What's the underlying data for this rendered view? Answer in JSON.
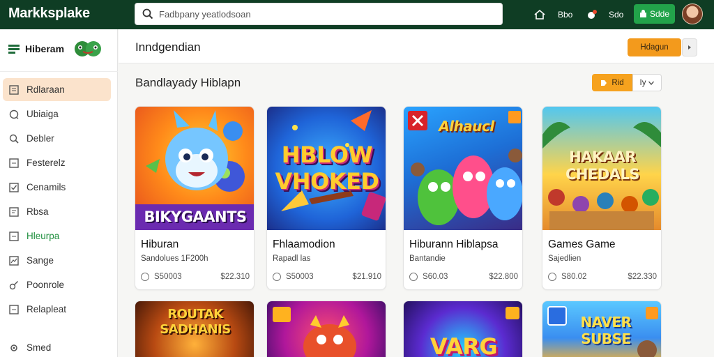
{
  "topbar": {
    "logo": "Markksplake",
    "search_placeholder": "Fadbpany yeatlodsoan",
    "home_label": "Bbo",
    "ns_label": "Sdo",
    "cta_label": "Sdde"
  },
  "sidebar": {
    "brand": "Hiberam",
    "items": [
      {
        "label": "Rdlaraan",
        "icon": "book-icon"
      },
      {
        "label": "Ubiaiga",
        "icon": "chat-icon"
      },
      {
        "label": "Debler",
        "icon": "search-icon"
      },
      {
        "label": "Festerelz",
        "icon": "square-icon"
      },
      {
        "label": "Cenamils",
        "icon": "checkbox-icon"
      },
      {
        "label": "Rbsa",
        "icon": "book-icon"
      },
      {
        "label": "Hleurpa",
        "icon": "square-icon"
      },
      {
        "label": "Sange",
        "icon": "chart-icon"
      },
      {
        "label": "Poonrole",
        "icon": "link-icon"
      },
      {
        "label": "Relapleat",
        "icon": "square-icon"
      },
      {
        "label": "Smed",
        "icon": "gear-icon"
      }
    ]
  },
  "header": {
    "title": "Inndgendian",
    "button_label": "Hdagun"
  },
  "section": {
    "title": "Bandlayady Hiblapn",
    "filter_label": "Rid",
    "sort_label": "Iy"
  },
  "cards": [
    {
      "art_text": "BIKYGAANTS",
      "title": "Hiburan",
      "subtitle": "Sandolues 1F200h",
      "count": "S50003",
      "price": "$22.310"
    },
    {
      "art_text": "HBLOW VHOKED",
      "title": "Fhlaamodion",
      "subtitle": "Rapadl las",
      "count": "S50003",
      "price": "$21.910"
    },
    {
      "art_text": "Alhaucl",
      "title": "Hiburann Hiblapsa",
      "subtitle": "Bantandie",
      "count": "S60.03",
      "price": "$22.800"
    },
    {
      "art_text": "HAKAAR CHEDALS",
      "title": "Games Game",
      "subtitle": "Sajedlien",
      "count": "S80.02",
      "price": "$22.330"
    }
  ],
  "bottom_cards": [
    {
      "art_text": "ROUTAK SADHANIS"
    },
    {
      "art_text": ""
    },
    {
      "art_text": "VARG"
    },
    {
      "art_text": "NAVER SUBSE"
    }
  ],
  "colors": {
    "topbar": "#0f3d24",
    "accent_orange": "#f39a1c",
    "accent_green": "#22a34a",
    "active_item_bg": "#fbe3cc"
  }
}
